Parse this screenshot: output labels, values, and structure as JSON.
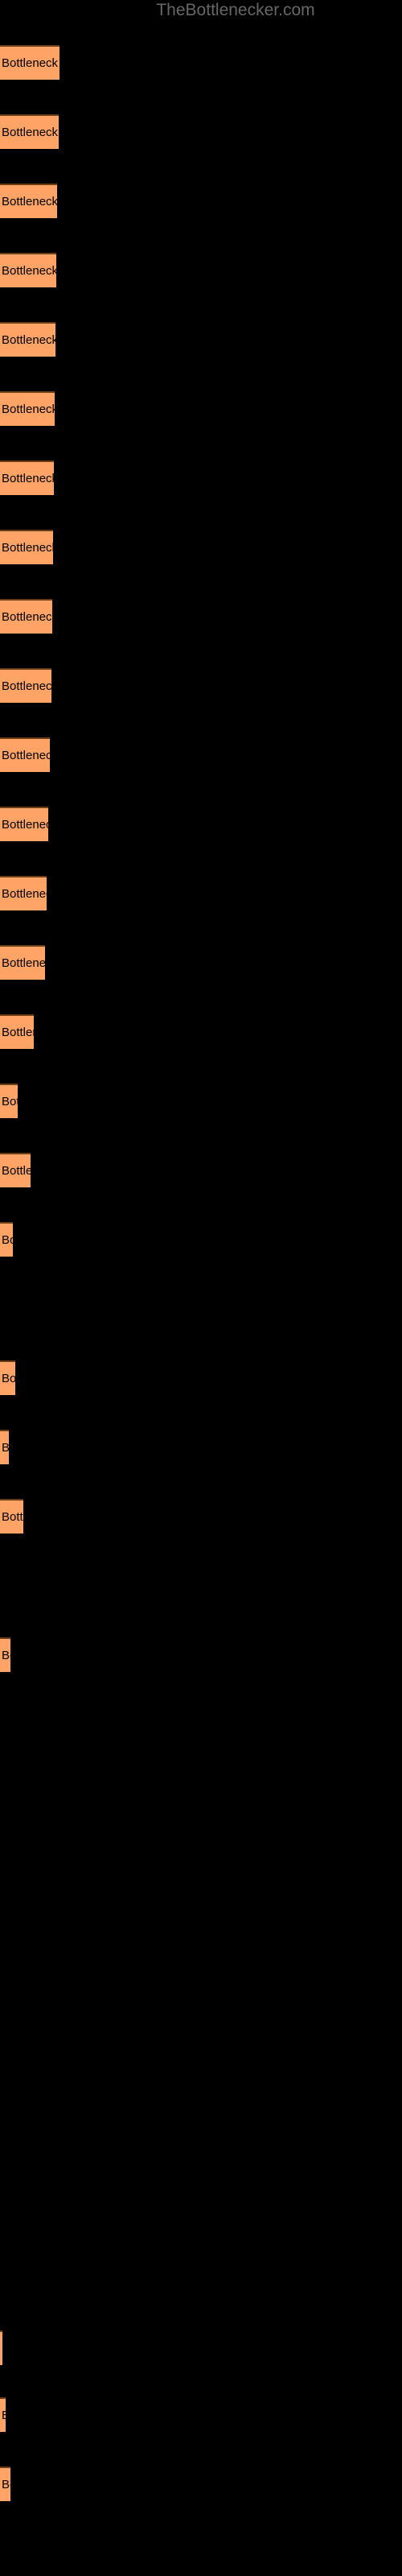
{
  "header": {
    "site_title": "TheBottlenecker.com"
  },
  "colors": {
    "background": "#000000",
    "bar_fill": "#ffa366",
    "bar_border_top": "#6b3d17",
    "label_text": "#000000",
    "title_text": "#666666"
  },
  "chart_data": {
    "type": "bar",
    "orientation": "horizontal",
    "title": "TheBottlenecker.com",
    "xlabel": "",
    "ylabel": "",
    "grid": false,
    "legend": "none",
    "bar_label_text": "Bottleneck result",
    "xlim": [
      0,
      500
    ],
    "categories": [
      "Bottleneck result",
      "Bottleneck result",
      "Bottleneck result",
      "Bottleneck result",
      "Bottleneck result",
      "Bottleneck result",
      "Bottleneck result",
      "Bottleneck result",
      "Bottleneck result",
      "Bottleneck result",
      "Bottleneck result",
      "Bottleneck result",
      "Bottleneck result",
      "Bottleneck result",
      "Bottleneck result",
      "Bottleneck result",
      "Bottleneck result",
      "Bottleneck result",
      "Bottleneck result",
      "Bottleneck result",
      "Bottleneck result",
      "Bottleneck result",
      "Bottleneck result",
      "Bottleneck result",
      "Bottleneck result",
      "Bottleneck result",
      "Bottleneck result"
    ],
    "values": [
      74,
      73,
      71,
      70,
      69,
      68,
      67,
      66,
      65,
      64,
      62,
      60,
      58,
      56,
      42,
      22,
      38,
      16,
      19,
      11,
      29,
      13,
      3,
      7,
      8,
      1,
      2
    ],
    "bars": [
      {
        "y": 56,
        "width": 74,
        "label": "Bottleneck result"
      },
      {
        "y": 142,
        "width": 73,
        "label": "Bottleneck result"
      },
      {
        "y": 228,
        "width": 71,
        "label": "Bottleneck result"
      },
      {
        "y": 314,
        "width": 70,
        "label": "Bottleneck result"
      },
      {
        "y": 400,
        "width": 69,
        "label": "Bottleneck result"
      },
      {
        "y": 486,
        "width": 68,
        "label": "Bottleneck result"
      },
      {
        "y": 572,
        "width": 67,
        "label": "Bottleneck result"
      },
      {
        "y": 658,
        "width": 66,
        "label": "Bottleneck result"
      },
      {
        "y": 744,
        "width": 65,
        "label": "Bottleneck result"
      },
      {
        "y": 830,
        "width": 64,
        "label": "Bottleneck result"
      },
      {
        "y": 916,
        "width": 62,
        "label": "Bottleneck result"
      },
      {
        "y": 1002,
        "width": 60,
        "label": "Bottleneck result"
      },
      {
        "y": 1088,
        "width": 58,
        "label": "Bottleneck result"
      },
      {
        "y": 1174,
        "width": 56,
        "label": "Bottleneck result"
      },
      {
        "y": 1260,
        "width": 42,
        "label": "Bottleneck result"
      },
      {
        "y": 1346,
        "width": 22,
        "label": "Bottleneck result"
      },
      {
        "y": 1432,
        "width": 38,
        "label": "Bottleneck result"
      },
      {
        "y": 1518,
        "width": 16,
        "label": "Bottleneck result"
      },
      {
        "y": 1690,
        "width": 19,
        "label": "Bottleneck result"
      },
      {
        "y": 1776,
        "width": 11,
        "label": "Bottleneck result"
      },
      {
        "y": 1862,
        "width": 29,
        "label": "Bottleneck result"
      },
      {
        "y": 2034,
        "width": 13,
        "label": "Bottleneck result"
      },
      {
        "y": 2895,
        "width": 3,
        "label": "Bottleneck result"
      },
      {
        "y": 2978,
        "width": 7,
        "label": "Bottleneck result"
      },
      {
        "y": 3064,
        "width": 13,
        "label": "Bottleneck result"
      }
    ]
  }
}
